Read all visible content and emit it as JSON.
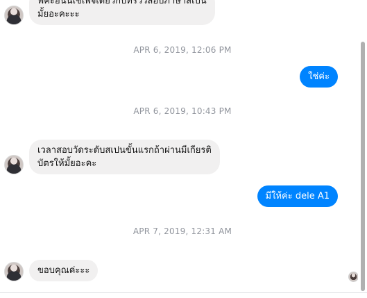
{
  "messages": {
    "m1_line1": "ฟคะอนนเชเพจเดยวกบทรววสอบภาษาสเปน",
    "m1_line2": "มั้ยอะคะะะ",
    "ts1": "APR 6, 2019, 12:06 PM",
    "m2": "ใช่ค่ะ",
    "ts2": "APR 6, 2019, 10:43 PM",
    "m3_line1": "เวลาสอบวัดระดับสเปนขั้นแรกถ้าผ่านมีเกียรติ",
    "m3_line2": "บัตรให้มั้ยอะคะ",
    "m4": "มีให้ค่ะ dele A1",
    "ts3": "APR 7, 2019, 12:31 AM",
    "m5": "ขอบคุณค่ะะะ"
  },
  "colors": {
    "outgoing": "#0084ff",
    "incoming": "#f1f0f0",
    "timestamp": "#90949c"
  }
}
